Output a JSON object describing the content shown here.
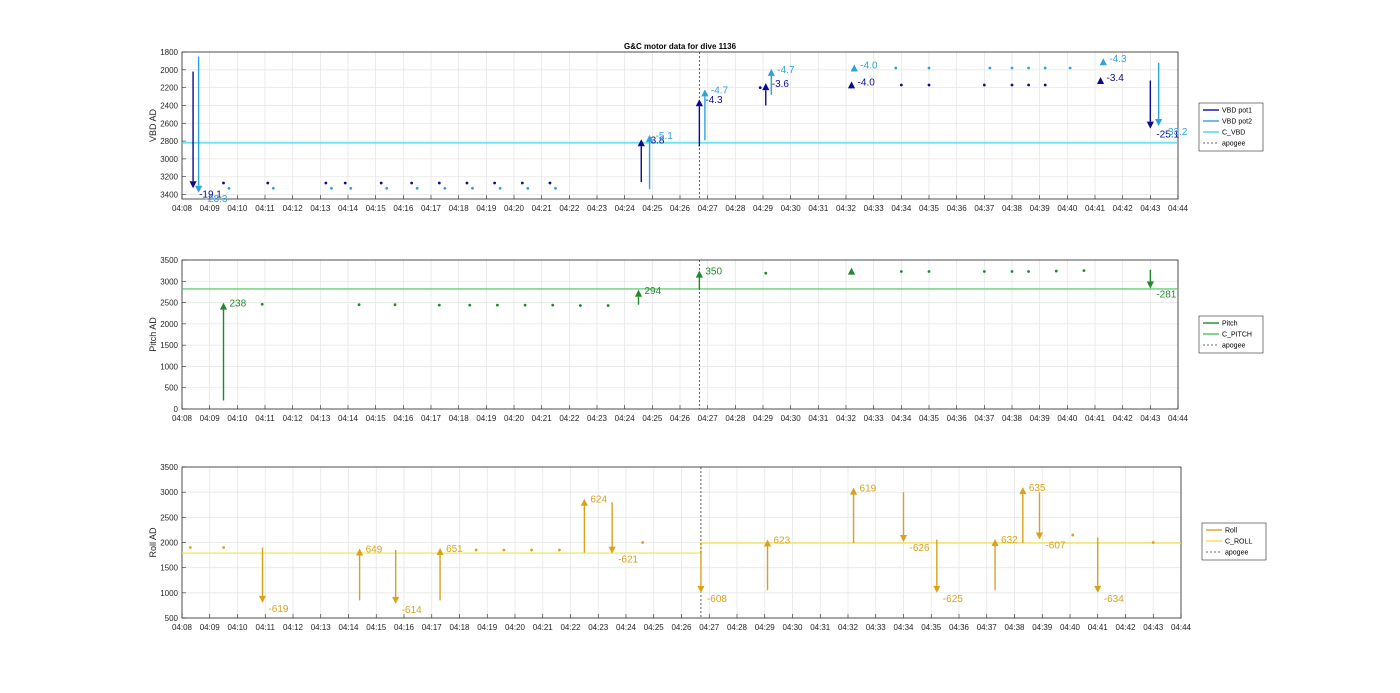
{
  "title": "G&C motor data for dive 1136",
  "x_ticks": [
    "04:08",
    "04:09",
    "04:10",
    "04:11",
    "04:12",
    "04:13",
    "04:14",
    "04:15",
    "04:16",
    "04:17",
    "04:18",
    "04:19",
    "04:20",
    "04:21",
    "04:22",
    "04:23",
    "04:24",
    "04:25",
    "04:26",
    "04:27",
    "04:28",
    "04:29",
    "04:30",
    "04:31",
    "04:32",
    "04:33",
    "04:34",
    "04:35",
    "04:36",
    "04:37",
    "04:38",
    "04:39",
    "04:40",
    "04:41",
    "04:42",
    "04:43",
    "04:44"
  ],
  "colors": {
    "vbd_pot1": "#0b0b8f",
    "vbd_pot2": "#2ea2dc",
    "c_vbd": "#3fd9e6",
    "pitch": "#1f8a2a",
    "c_pitch": "#4cc35a",
    "roll": "#d9a21c",
    "c_roll": "#f2e24a",
    "apogee": "#333333"
  },
  "chart_data": [
    {
      "type": "scatter",
      "ylabel": "VBD AD",
      "ylim": [
        1800,
        3450
      ],
      "y_reversed": true,
      "yticks": [
        1800,
        2000,
        2200,
        2400,
        2600,
        2800,
        3000,
        3200,
        3400
      ],
      "legend": [
        "VBD pot1",
        "VBD pot2",
        "C_VBD",
        "apogee"
      ],
      "legend_position": "right",
      "grid": true,
      "apogee_x": 18.7,
      "reference_line": {
        "name": "C_VBD",
        "segments": [
          [
            0,
            2820
          ],
          [
            36,
            2820
          ]
        ]
      },
      "series": [
        {
          "name": "VBD pot1",
          "color_key": "vbd_pot1",
          "points": [
            [
              1.5,
              3270
            ],
            [
              3.1,
              3270
            ],
            [
              5.2,
              3270
            ],
            [
              5.9,
              3270
            ],
            [
              7.2,
              3270
            ],
            [
              8.3,
              3270
            ],
            [
              9.3,
              3270
            ],
            [
              10.3,
              3270
            ],
            [
              11.3,
              3270
            ],
            [
              12.3,
              3270
            ],
            [
              13.3,
              3270
            ],
            [
              20.9,
              2200
            ],
            [
              24.2,
              2170
            ],
            [
              26.0,
              2170
            ],
            [
              27.0,
              2170
            ],
            [
              29.0,
              2170
            ],
            [
              30.0,
              2170
            ],
            [
              30.6,
              2170
            ],
            [
              31.2,
              2170
            ]
          ]
        },
        {
          "name": "VBD pot2",
          "color_key": "vbd_pot2",
          "points": [
            [
              1.7,
              3330
            ],
            [
              3.3,
              3330
            ],
            [
              5.4,
              3330
            ],
            [
              6.1,
              3330
            ],
            [
              7.4,
              3330
            ],
            [
              8.5,
              3330
            ],
            [
              9.5,
              3330
            ],
            [
              10.5,
              3330
            ],
            [
              11.5,
              3330
            ],
            [
              12.5,
              3330
            ],
            [
              13.5,
              3330
            ],
            [
              25.8,
              1980
            ],
            [
              27.0,
              1980
            ],
            [
              29.2,
              1980
            ],
            [
              30.0,
              1980
            ],
            [
              30.6,
              1980
            ],
            [
              31.2,
              1980
            ],
            [
              32.1,
              1980
            ]
          ]
        }
      ],
      "moves": [
        {
          "series": "VBD pot1",
          "x": 0.4,
          "y_start": 2020,
          "y_end": 3330,
          "label": "-19.1"
        },
        {
          "series": "VBD pot2",
          "x": 0.6,
          "y_start": 1850,
          "y_end": 3380,
          "label": "-23.3"
        },
        {
          "series": "VBD pot1",
          "x": 16.6,
          "y_start": 3260,
          "y_end": 2780,
          "label": "-3.8"
        },
        {
          "series": "VBD pot2",
          "x": 16.9,
          "y_start": 3340,
          "y_end": 2730,
          "label": "-5.1"
        },
        {
          "series": "VBD pot1",
          "x": 18.7,
          "y_start": 2860,
          "y_end": 2330,
          "label": "-4.3"
        },
        {
          "series": "VBD pot2",
          "x": 18.9,
          "y_start": 2790,
          "y_end": 2220,
          "label": "-4.7"
        },
        {
          "series": "VBD pot1",
          "x": 21.1,
          "y_start": 2400,
          "y_end": 2150,
          "label": "-3.6"
        },
        {
          "series": "VBD pot2",
          "x": 21.3,
          "y_start": 2280,
          "y_end": 1990,
          "label": "-4.7"
        },
        {
          "series": "VBD pot1",
          "x": 24.2,
          "y_start": 2210,
          "y_end": 2130,
          "label": "-4.0"
        },
        {
          "series": "VBD pot2",
          "x": 24.3,
          "y_start": 2010,
          "y_end": 1940,
          "label": "-4.0"
        },
        {
          "series": "VBD pot1",
          "x": 33.2,
          "y_start": 2150,
          "y_end": 2080,
          "label": "-3.4"
        },
        {
          "series": "VBD pot2",
          "x": 33.3,
          "y_start": 1940,
          "y_end": 1870,
          "label": "-4.3"
        },
        {
          "series": "VBD pot1",
          "x": 35.0,
          "y_start": 2120,
          "y_end": 2660,
          "label": "-25.1"
        },
        {
          "series": "VBD pot2",
          "x": 35.3,
          "y_start": 1920,
          "y_end": 2630,
          "label": "-33.2"
        }
      ]
    },
    {
      "type": "scatter",
      "ylabel": "Pitch AD",
      "ylim": [
        0,
        3500
      ],
      "y_reversed": false,
      "yticks": [
        0,
        500,
        1000,
        1500,
        2000,
        2500,
        3000,
        3500
      ],
      "legend": [
        "Pitch",
        "C_PITCH",
        "apogee"
      ],
      "legend_position": "right",
      "grid": true,
      "apogee_x": 18.7,
      "reference_line": {
        "name": "C_PITCH",
        "segments": [
          [
            0,
            2820
          ],
          [
            36,
            2820
          ]
        ]
      },
      "series": [
        {
          "name": "Pitch",
          "color_key": "pitch",
          "points": [
            [
              2.9,
              2460
            ],
            [
              6.4,
              2450
            ],
            [
              7.7,
              2450
            ],
            [
              9.3,
              2440
            ],
            [
              10.4,
              2440
            ],
            [
              11.4,
              2440
            ],
            [
              12.4,
              2440
            ],
            [
              13.4,
              2440
            ],
            [
              14.4,
              2430
            ],
            [
              15.4,
              2430
            ],
            [
              21.1,
              3190
            ],
            [
              26.0,
              3230
            ],
            [
              27.0,
              3230
            ],
            [
              29.0,
              3230
            ],
            [
              30.0,
              3230
            ],
            [
              30.6,
              3230
            ],
            [
              31.6,
              3240
            ],
            [
              32.6,
              3250
            ]
          ]
        }
      ],
      "moves": [
        {
          "series": "Pitch",
          "x": 1.5,
          "y_start": 200,
          "y_end": 2500,
          "label": "238"
        },
        {
          "series": "Pitch",
          "x": 16.5,
          "y_start": 2450,
          "y_end": 2800,
          "label": "294"
        },
        {
          "series": "Pitch",
          "x": 18.7,
          "y_start": 2820,
          "y_end": 3250,
          "label": "350"
        },
        {
          "series": "Pitch",
          "x": 24.2,
          "y_start": 3260,
          "y_end": 3320,
          "label": ""
        },
        {
          "series": "Pitch",
          "x": 35.0,
          "y_start": 3270,
          "y_end": 2830,
          "label": "-281"
        }
      ]
    },
    {
      "type": "scatter",
      "ylabel": "Roll AD",
      "ylim": [
        500,
        3500
      ],
      "y_reversed": false,
      "yticks": [
        500,
        1000,
        1500,
        2000,
        2500,
        3000,
        3500
      ],
      "legend": [
        "Roll",
        "C_ROLL",
        "apogee"
      ],
      "legend_position": "right",
      "grid": true,
      "apogee_x": 18.7,
      "reference_line": {
        "name": "C_ROLL",
        "segments": [
          [
            0,
            1790
          ],
          [
            18.7,
            1790
          ],
          [
            18.7,
            1990
          ],
          [
            36,
            1990
          ]
        ]
      },
      "series": [
        {
          "name": "Roll",
          "color_key": "roll",
          "points": [
            [
              0.3,
              1900
            ],
            [
              1.5,
              1900
            ],
            [
              10.6,
              1850
            ],
            [
              11.6,
              1850
            ],
            [
              12.6,
              1850
            ],
            [
              13.6,
              1850
            ],
            [
              16.6,
              2000
            ],
            [
              32.1,
              2150
            ],
            [
              35.0,
              2000
            ]
          ]
        }
      ],
      "moves": [
        {
          "series": "Roll",
          "x": 2.9,
          "y_start": 1900,
          "y_end": 800,
          "label": "-619"
        },
        {
          "series": "Roll",
          "x": 6.4,
          "y_start": 850,
          "y_end": 1880,
          "label": "649"
        },
        {
          "series": "Roll",
          "x": 7.7,
          "y_start": 1850,
          "y_end": 780,
          "label": "-614"
        },
        {
          "series": "Roll",
          "x": 9.3,
          "y_start": 850,
          "y_end": 1890,
          "label": "651"
        },
        {
          "series": "Roll",
          "x": 14.5,
          "y_start": 1800,
          "y_end": 2870,
          "label": "624"
        },
        {
          "series": "Roll",
          "x": 15.5,
          "y_start": 2800,
          "y_end": 1780,
          "label": "-621"
        },
        {
          "series": "Roll",
          "x": 18.7,
          "y_start": 1800,
          "y_end": 1000,
          "label": "-608"
        },
        {
          "series": "Roll",
          "x": 21.1,
          "y_start": 1050,
          "y_end": 2060,
          "label": "623"
        },
        {
          "series": "Roll",
          "x": 24.2,
          "y_start": 1990,
          "y_end": 3090,
          "label": "619"
        },
        {
          "series": "Roll",
          "x": 26.0,
          "y_start": 3000,
          "y_end": 2010,
          "label": "-626"
        },
        {
          "series": "Roll",
          "x": 27.2,
          "y_start": 2060,
          "y_end": 1000,
          "label": "-625"
        },
        {
          "series": "Roll",
          "x": 29.3,
          "y_start": 1050,
          "y_end": 2070,
          "label": "632"
        },
        {
          "series": "Roll",
          "x": 30.3,
          "y_start": 1990,
          "y_end": 3100,
          "label": "635"
        },
        {
          "series": "Roll",
          "x": 30.9,
          "y_start": 3000,
          "y_end": 2060,
          "label": "-607"
        },
        {
          "series": "Roll",
          "x": 33.0,
          "y_start": 2100,
          "y_end": 1000,
          "label": "-634"
        }
      ]
    }
  ]
}
